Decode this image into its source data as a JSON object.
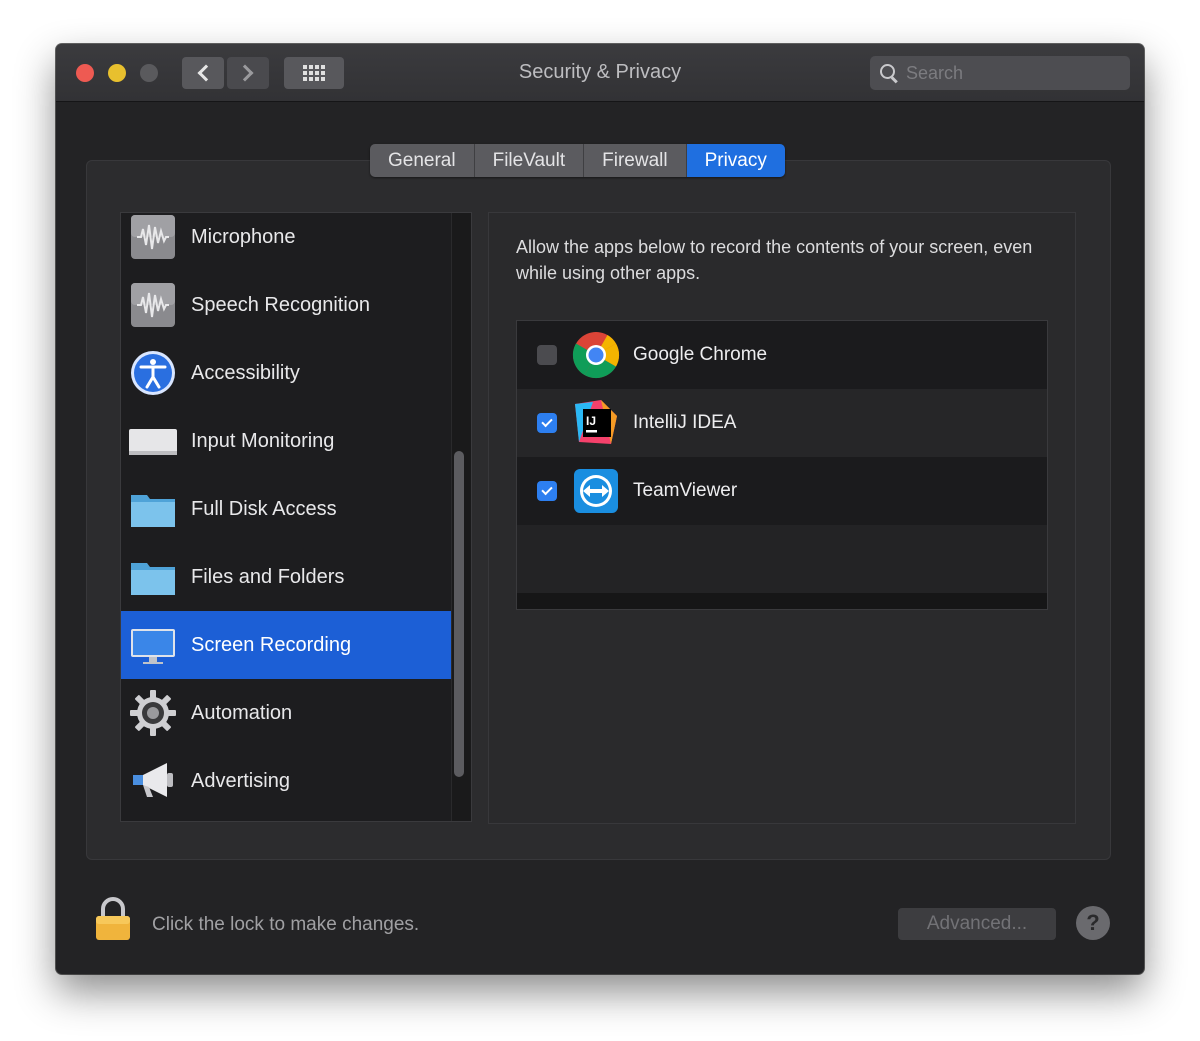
{
  "window": {
    "title": "Security & Privacy",
    "search_placeholder": "Search"
  },
  "tabs": [
    {
      "label": "General"
    },
    {
      "label": "FileVault"
    },
    {
      "label": "Firewall"
    },
    {
      "label": "Privacy",
      "active": true
    }
  ],
  "sidebar": {
    "items": [
      {
        "label": "Microphone",
        "icon": "microphone-icon"
      },
      {
        "label": "Speech Recognition",
        "icon": "speech-recognition-icon"
      },
      {
        "label": "Accessibility",
        "icon": "accessibility-icon"
      },
      {
        "label": "Input Monitoring",
        "icon": "keyboard-icon"
      },
      {
        "label": "Full Disk Access",
        "icon": "folder-icon"
      },
      {
        "label": "Files and Folders",
        "icon": "folder-icon"
      },
      {
        "label": "Screen Recording",
        "icon": "display-icon",
        "selected": true
      },
      {
        "label": "Automation",
        "icon": "gear-icon"
      },
      {
        "label": "Advertising",
        "icon": "megaphone-icon"
      }
    ]
  },
  "panel": {
    "description": "Allow the apps below to record the contents of your screen, even while using other apps.",
    "apps": [
      {
        "name": "Google Chrome",
        "checked": false,
        "icon": "chrome-icon"
      },
      {
        "name": "IntelliJ IDEA",
        "checked": true,
        "icon": "intellij-icon"
      },
      {
        "name": "TeamViewer",
        "checked": true,
        "icon": "teamviewer-icon"
      }
    ]
  },
  "footer": {
    "lock_text": "Click the lock to make changes.",
    "advanced_label": "Advanced...",
    "help_label": "?"
  },
  "colors": {
    "accent": "#1f6fe0",
    "selection": "#1c5fd6",
    "window_bg": "#232325"
  }
}
